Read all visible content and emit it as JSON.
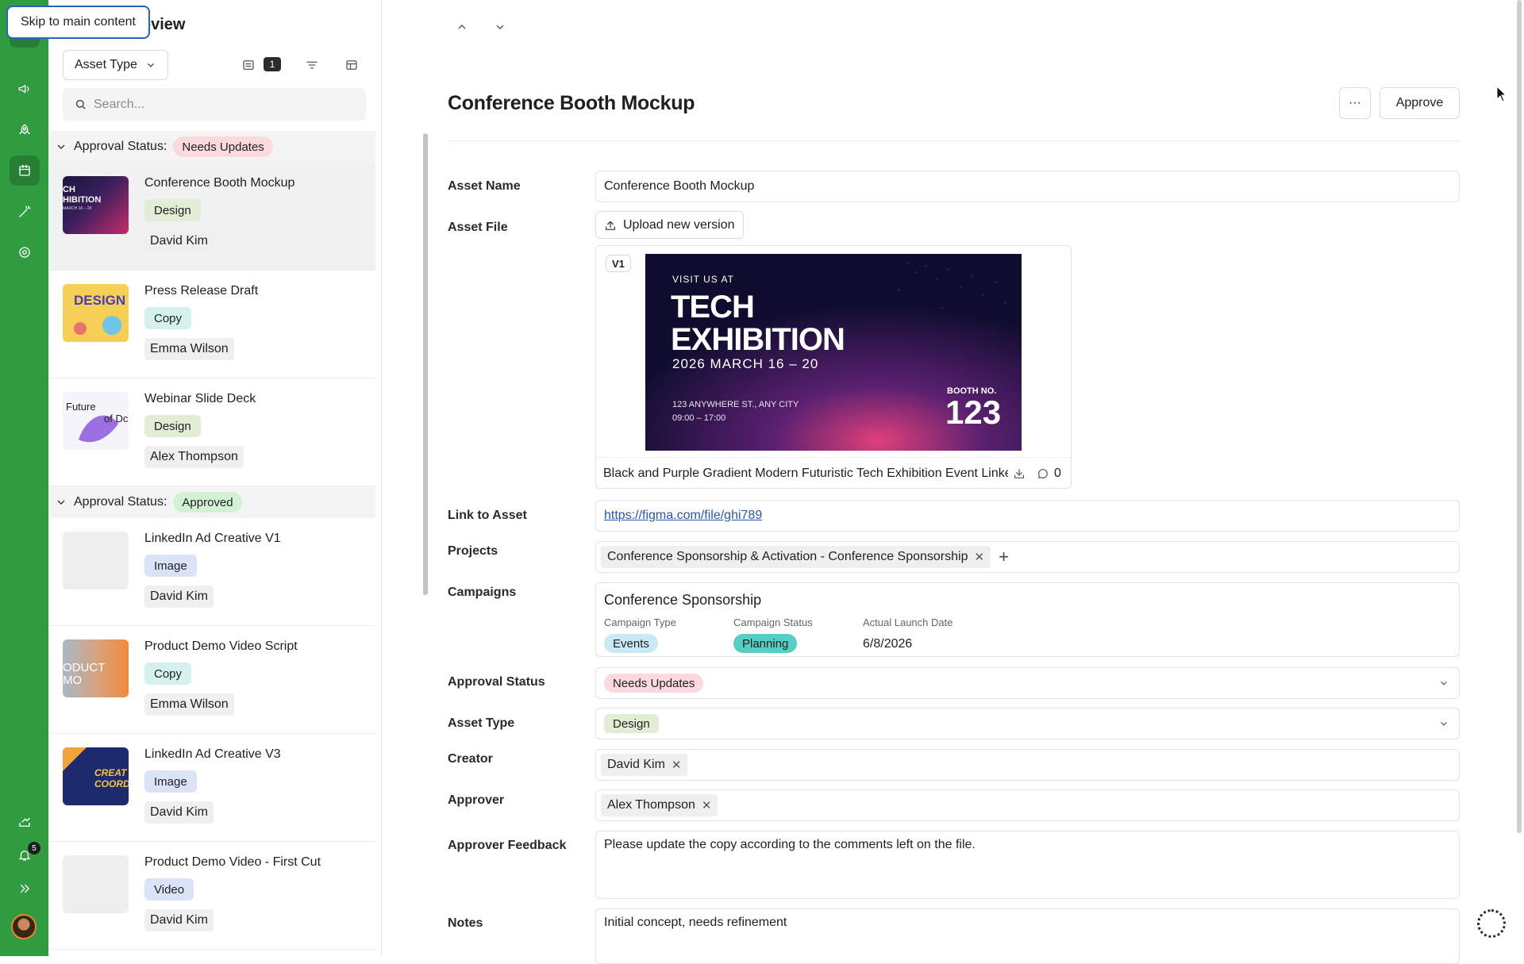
{
  "skip_link": "Skip to main content",
  "panel": {
    "title": "eview",
    "type_filter": "Asset Type",
    "count": "1",
    "search_placeholder": "Search..."
  },
  "groups": [
    {
      "label": "Approval Status:",
      "status": "Needs Updates",
      "status_color": "#fbd9dc",
      "items": [
        {
          "title": "Conference Booth Mockup",
          "tag": "Design",
          "person": "David Kim"
        },
        {
          "title": "Press Release Draft",
          "tag": "Copy",
          "person": "Emma Wilson"
        },
        {
          "title": "Webinar Slide Deck",
          "tag": "Design",
          "person": "Alex Thompson"
        }
      ]
    },
    {
      "label": "Approval Status:",
      "status": "Approved",
      "status_color": "#d3f2d3",
      "items": [
        {
          "title": "LinkedIn Ad Creative V1",
          "tag": "Image",
          "person": "David Kim"
        },
        {
          "title": "Product Demo Video Script",
          "tag": "Copy",
          "person": "Emma Wilson"
        },
        {
          "title": "LinkedIn Ad Creative V3",
          "tag": "Image",
          "person": "David Kim"
        },
        {
          "title": "Product Demo Video - First Cut",
          "tag": "Video",
          "person": "David Kim"
        }
      ]
    }
  ],
  "thumb_texts": {
    "booth": "CH\nHIBITION",
    "design": "DESIGN",
    "future": "Future\nof Dc",
    "product": "ODUCT\nMO",
    "creat": "CREAT\nCOORD"
  },
  "rail": {
    "notification_count": "5",
    "icons": [
      "logo-icon",
      "megaphone-icon",
      "rocket-icon",
      "calendar-icon",
      "magic-wand-icon",
      "at-sign-icon",
      "share-icon",
      "bell-icon",
      "expand-icon"
    ]
  },
  "detail": {
    "title": "Conference Booth Mockup",
    "more_label": "···",
    "approve_label": "Approve",
    "labels": {
      "asset_name": "Asset Name",
      "asset_file": "Asset File",
      "link": "Link to Asset",
      "projects": "Projects",
      "campaigns": "Campaigns",
      "approval_status": "Approval Status",
      "asset_type": "Asset Type",
      "creator": "Creator",
      "approver": "Approver",
      "feedback": "Approver Feedback",
      "notes": "Notes"
    },
    "asset_name": "Conference Booth Mockup",
    "upload_label": "Upload new version",
    "file": {
      "version": "V1",
      "name": "Black and Purple Gradient Modern Futuristic Tech Exhibition Event Linke",
      "comments": "0",
      "preview": {
        "kicker": "VISIT US AT",
        "line1": "TECH",
        "line2": "EXHIBITION",
        "dates": "2026 MARCH 16 – 20",
        "address": "123 ANYWHERE ST., ANY CITY",
        "hours": "09:00 – 17:00",
        "booth_label": "BOOTH NO.",
        "booth_no": "123"
      }
    },
    "link": "https://figma.com/file/ghi789",
    "project": "Conference Sponsorship & Activation - Conference Sponsorship",
    "campaign": {
      "name": "Conference Sponsorship",
      "type_label": "Campaign Type",
      "type": "Events",
      "status_label": "Campaign Status",
      "status": "Planning",
      "date_label": "Actual Launch Date",
      "date": "6/8/2026"
    },
    "approval_status": "Needs Updates",
    "asset_type": "Design",
    "creator": "David Kim",
    "approver": "Alex Thompson",
    "feedback": "Please update the copy according to the comments left on the file.",
    "notes": "Initial concept, needs refinement"
  },
  "colors": {
    "rail": "#2f9c3f",
    "needs_updates": "#fbd9dc",
    "approved": "#d3f2d3",
    "planning": "#55cfc4",
    "link": "#2457b7"
  }
}
